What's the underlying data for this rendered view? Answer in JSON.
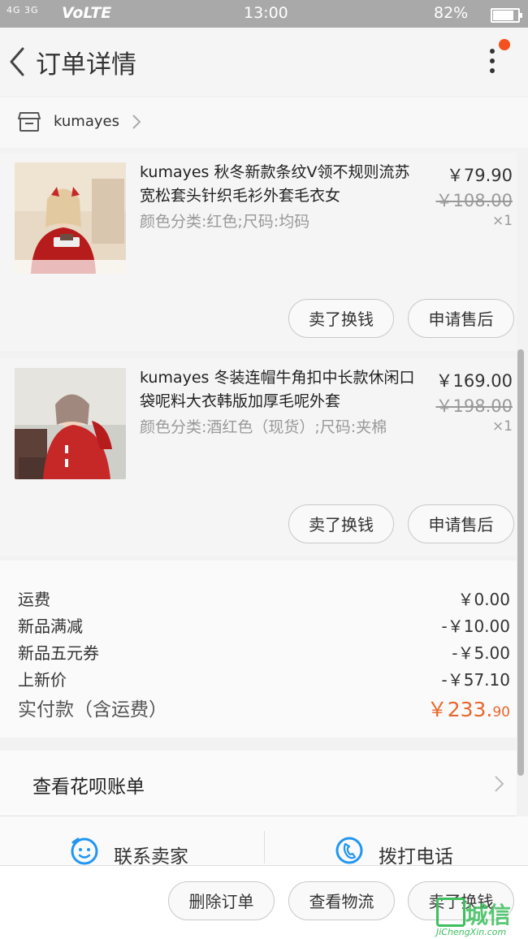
{
  "status_bar": {
    "signal": "4G 3G",
    "network": "VoLTE",
    "time": "13:00",
    "battery": "82%"
  },
  "header": {
    "title": "订单详情"
  },
  "shop": {
    "name": "kumayes"
  },
  "items": [
    {
      "name": "kumayes 秋冬新款条纹V领不规则流苏宽松套头针织毛衫外套毛衣女",
      "spec": "颜色分类:红色;尺码:均码",
      "price": "￥79.90",
      "original_price": "￥108.00",
      "qty": "×1",
      "btn_resell": "卖了换钱",
      "btn_aftersale": "申请售后"
    },
    {
      "name": "kumayes 冬装连帽牛角扣中长款休闲口袋呢料大衣韩版加厚毛呢外套",
      "spec": "颜色分类:酒红色（现货）;尺码:夹棉",
      "price": "￥169.00",
      "original_price": "￥198.00",
      "qty": "×1",
      "btn_resell": "卖了换钱",
      "btn_aftersale": "申请售后"
    }
  ],
  "fees": [
    {
      "label": "运费",
      "value": "￥0.00"
    },
    {
      "label": "新品满减",
      "value": "-￥10.00"
    },
    {
      "label": "新品五元券",
      "value": "-￥5.00"
    },
    {
      "label": "上新价",
      "value": "-￥57.10"
    }
  ],
  "total": {
    "label": "实付款（含运费）",
    "value_main": "￥233.",
    "value_cents": "90"
  },
  "huabei": {
    "label": "查看花呗账单"
  },
  "contact": {
    "seller": "联系卖家",
    "call": "拨打电话"
  },
  "bottom_actions": {
    "delete": "删除订单",
    "logistics": "查看物流",
    "resell": "卖了换钱"
  },
  "watermark": {
    "text": "城信",
    "url": "JiChengXin.com"
  },
  "colors": {
    "accent": "#e8672c",
    "contact_icon": "#2196f3",
    "notif_dot": "#f4511e"
  }
}
